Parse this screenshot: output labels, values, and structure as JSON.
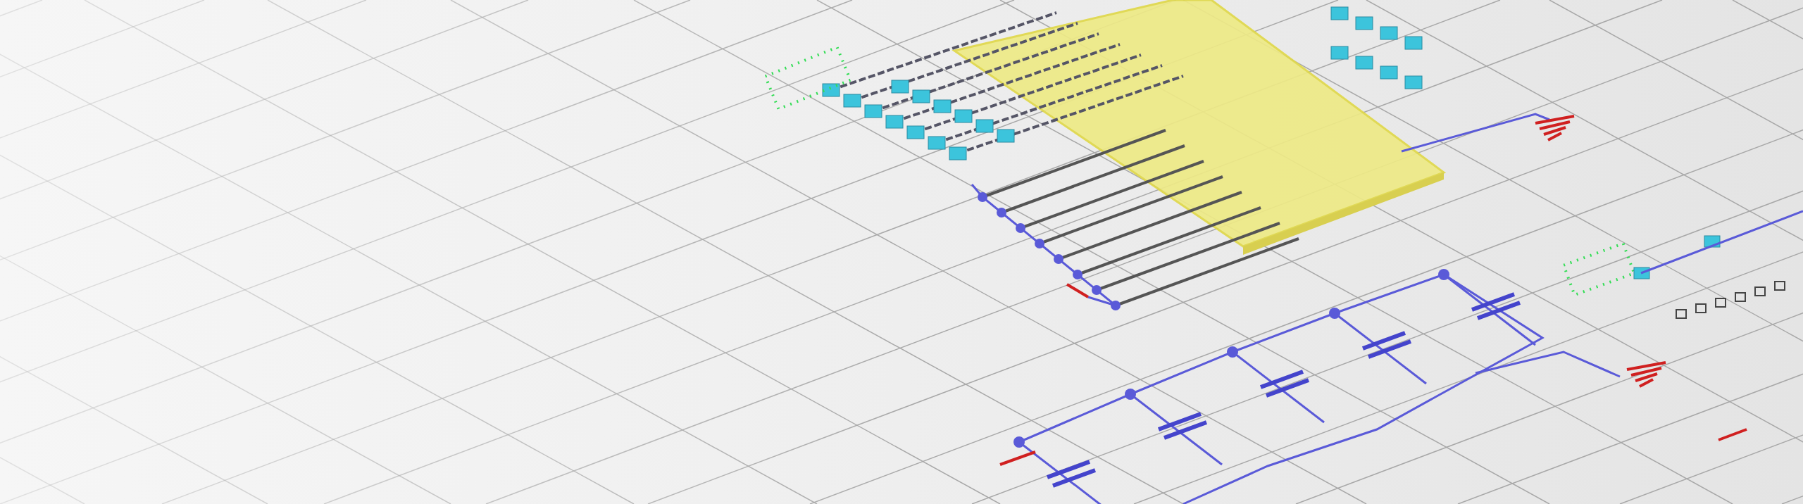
{
  "banner": {
    "image": {
      "kind": "schematic-render"
    }
  }
}
